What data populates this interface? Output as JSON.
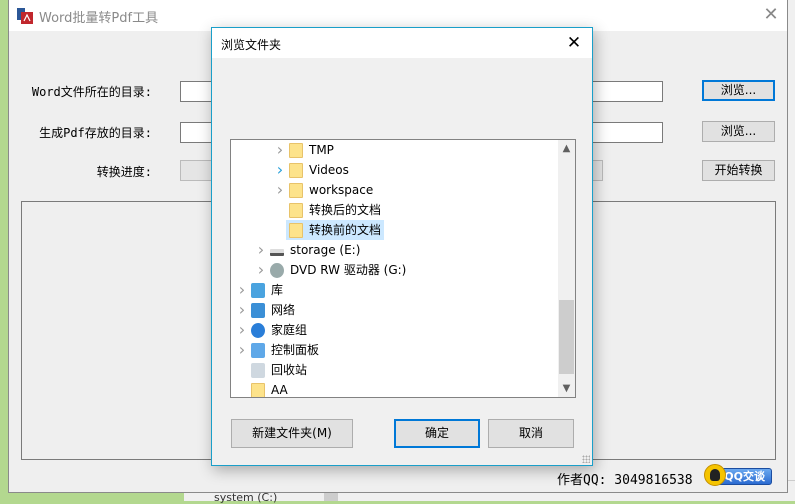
{
  "main_window": {
    "title": "Word批量转Pdf工具",
    "close_glyph": "✕",
    "word_dir_label": "Word文件所在的目录:",
    "pdf_dir_label": "生成Pdf存放的目录:",
    "progress_label": "转换进度:",
    "word_dir_value": "",
    "pdf_dir_value": "",
    "browse1_label": "浏览...",
    "browse2_label": "浏览...",
    "start_label": "开始转换",
    "author_text": "作者QQ: 3049816538",
    "qq_badge_label": "QQ交谈"
  },
  "dialog": {
    "title": "浏览文件夹",
    "close_glyph": "✕",
    "tree": [
      {
        "label": "TMP",
        "icon": "folder-icon",
        "chevron": true,
        "chevron_highlight": false,
        "selected": false,
        "level": 3
      },
      {
        "label": "Videos",
        "icon": "folder-icon",
        "chevron": true,
        "chevron_highlight": true,
        "selected": false,
        "level": 3
      },
      {
        "label": "workspace",
        "icon": "folder-icon",
        "chevron": true,
        "chevron_highlight": false,
        "selected": false,
        "level": 3
      },
      {
        "label": "转换后的文档",
        "icon": "folder-icon",
        "chevron": false,
        "chevron_highlight": false,
        "selected": false,
        "level": 3
      },
      {
        "label": "转换前的文档",
        "icon": "folder-icon",
        "chevron": false,
        "chevron_highlight": false,
        "selected": true,
        "level": 3
      },
      {
        "label": "storage (E:)",
        "icon": "drive-icon",
        "chevron": true,
        "chevron_highlight": false,
        "selected": false,
        "level": 2
      },
      {
        "label": "DVD RW 驱动器 (G:)",
        "icon": "dvd-drive-icon",
        "chevron": true,
        "chevron_highlight": false,
        "selected": false,
        "level": 2
      },
      {
        "label": "库",
        "icon": "library-icon",
        "chevron": true,
        "chevron_highlight": false,
        "selected": false,
        "level": 1
      },
      {
        "label": "网络",
        "icon": "network-icon",
        "chevron": true,
        "chevron_highlight": false,
        "selected": false,
        "level": 1
      },
      {
        "label": "家庭组",
        "icon": "homegroup-icon",
        "chevron": true,
        "chevron_highlight": false,
        "selected": false,
        "level": 1
      },
      {
        "label": "控制面板",
        "icon": "control-panel-icon",
        "chevron": true,
        "chevron_highlight": false,
        "selected": false,
        "level": 1
      },
      {
        "label": "回收站",
        "icon": "recycle-bin-icon",
        "chevron": false,
        "chevron_highlight": false,
        "selected": false,
        "level": 1
      },
      {
        "label": "AA",
        "icon": "folder-icon",
        "chevron": false,
        "chevron_highlight": false,
        "selected": false,
        "level": 1
      }
    ],
    "new_folder_label": "新建文件夹(M)",
    "ok_label": "确定",
    "cancel_label": "取消"
  },
  "background": {
    "taskbar_item": "system (C:)",
    "colors": {
      "accent": "#0078d7",
      "dialog_border": "#1a9fc9",
      "selection": "#cce8ff",
      "folder": "#fde38b"
    }
  }
}
